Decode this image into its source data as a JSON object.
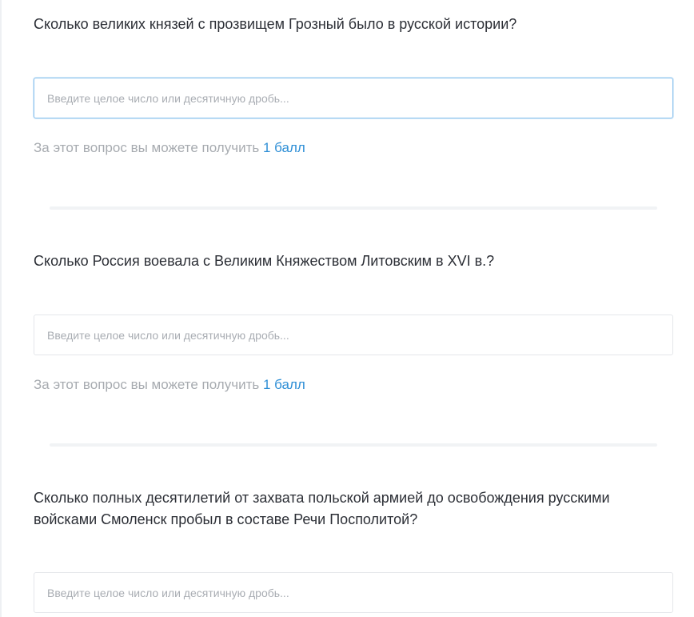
{
  "questions": [
    {
      "text": "Сколько великих князей с прозвищем Грозный было в русской истории?",
      "placeholder": "Введите целое число или десятичную дробь...",
      "points_prefix": "За этот вопрос вы можете получить",
      "points_value": "1 балл"
    },
    {
      "text": "Сколько Россия воевала с Великим Княжеством Литовским в XVI в.?",
      "placeholder": "Введите целое число или десятичную дробь...",
      "points_prefix": "За этот вопрос вы можете получить",
      "points_value": "1 балл"
    },
    {
      "text": "Сколько полных десятилетий от захвата польской армией до освобождения русскими войсками Смоленск пробыл в составе Речи Посполитой?",
      "placeholder": "Введите целое число или десятичную дробь..."
    }
  ],
  "colors": {
    "accent": "#2f8fd6",
    "muted_text": "#a7abb0",
    "focus_border": "#8cc3ee"
  }
}
